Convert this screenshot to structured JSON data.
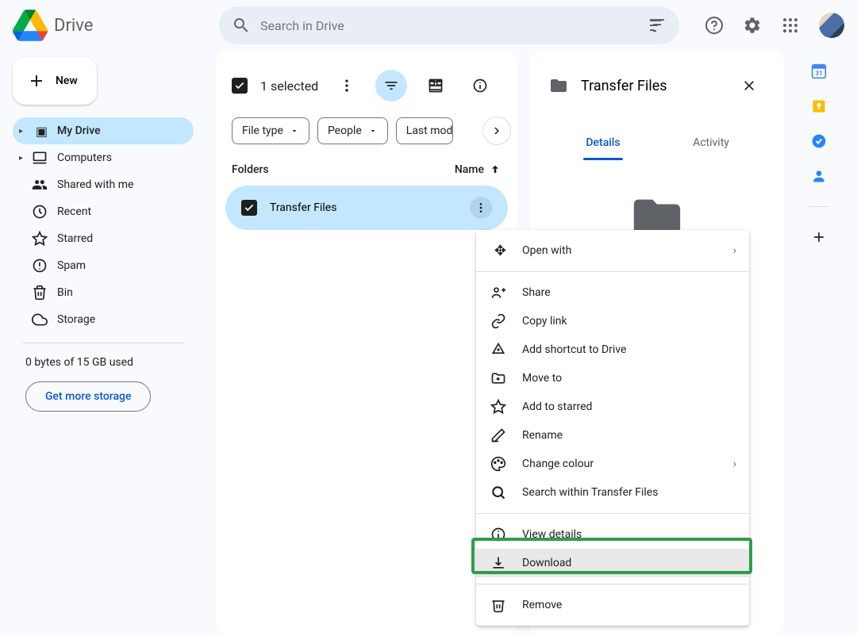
{
  "header": {
    "app_name": "Drive",
    "search_placeholder": "Search in Drive"
  },
  "sidebar": {
    "new_label": "New",
    "nav": [
      {
        "label": "My Drive",
        "icon": "drive",
        "active": true,
        "expandable": true
      },
      {
        "label": "Computers",
        "icon": "computers",
        "expandable": true
      },
      {
        "label": "Shared with me",
        "icon": "shared"
      },
      {
        "label": "Recent",
        "icon": "recent"
      },
      {
        "label": "Starred",
        "icon": "star"
      },
      {
        "label": "Spam",
        "icon": "spam"
      },
      {
        "label": "Bin",
        "icon": "bin"
      },
      {
        "label": "Storage",
        "icon": "storage"
      }
    ],
    "storage_text": "0 bytes of 15 GB used",
    "storage_btn": "Get more storage"
  },
  "content": {
    "selection": "1 selected",
    "chips": [
      "File type",
      "People",
      "Last modified"
    ],
    "folders_header": "Folders",
    "sort_col": "Name",
    "folder_name": "Transfer Files"
  },
  "details": {
    "title": "Transfer Files",
    "tab_details": "Details",
    "tab_activity": "Activity"
  },
  "menu": {
    "open_with": "Open with",
    "share": "Share",
    "copy_link": "Copy link",
    "add_shortcut": "Add shortcut to Drive",
    "move_to": "Move to",
    "add_starred": "Add to starred",
    "rename": "Rename",
    "change_colour": "Change colour",
    "search_within": "Search within Transfer Files",
    "view_details": "View details",
    "download": "Download",
    "remove": "Remove"
  }
}
